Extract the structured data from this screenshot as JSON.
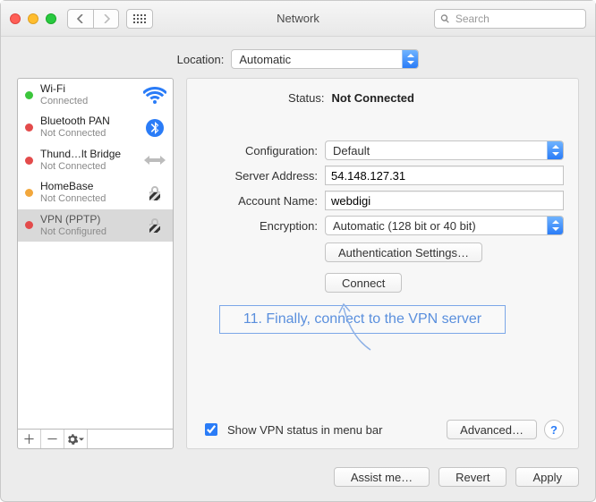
{
  "window": {
    "title": "Network",
    "search_placeholder": "Search"
  },
  "location": {
    "label": "Location:",
    "value": "Automatic"
  },
  "sidebar": {
    "items": [
      {
        "name": "Wi-Fi",
        "status": "Connected",
        "dot": "green",
        "icon": "wifi"
      },
      {
        "name": "Bluetooth PAN",
        "status": "Not Connected",
        "dot": "red",
        "icon": "bluetooth"
      },
      {
        "name": "Thund…lt Bridge",
        "status": "Not Connected",
        "dot": "red",
        "icon": "thunderbolt"
      },
      {
        "name": "HomeBase",
        "status": "Not Connected",
        "dot": "orange",
        "icon": "lock"
      },
      {
        "name": "VPN (PPTP)",
        "status": "Not Configured",
        "dot": "red",
        "icon": "lock"
      }
    ],
    "selected_index": 4
  },
  "detail": {
    "status_label": "Status:",
    "status_value": "Not Connected",
    "configuration_label": "Configuration:",
    "configuration_value": "Default",
    "server_address_label": "Server Address:",
    "server_address_value": "54.148.127.31",
    "account_name_label": "Account Name:",
    "account_name_value": "webdigi",
    "encryption_label": "Encryption:",
    "encryption_value": "Automatic (128 bit or 40 bit)",
    "auth_settings_btn": "Authentication Settings…",
    "connect_btn": "Connect",
    "show_status_label": "Show VPN status in menu bar",
    "show_status_checked": true,
    "advanced_btn": "Advanced…"
  },
  "annotation": {
    "text": "11. Finally, connect to the VPN server"
  },
  "footer": {
    "assist_btn": "Assist me…",
    "revert_btn": "Revert",
    "apply_btn": "Apply"
  }
}
